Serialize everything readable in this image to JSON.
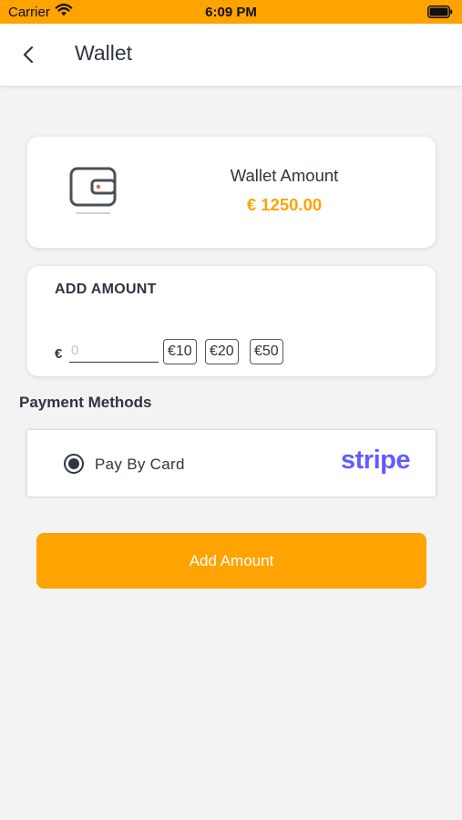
{
  "status_bar": {
    "carrier": "Carrier",
    "time": "6:09 PM"
  },
  "header": {
    "title": "Wallet"
  },
  "wallet": {
    "label": "Wallet Amount",
    "amount": "€ 1250.00"
  },
  "add_amount": {
    "heading": "ADD AMOUNT",
    "currency_symbol": "€",
    "input_value": "",
    "input_placeholder": "0",
    "quick_amounts": [
      "€10",
      "€20",
      "€50"
    ]
  },
  "payment": {
    "section_title": "Payment Methods",
    "method_label": "Pay By Card",
    "provider_logo": "stripe",
    "selected": true
  },
  "submit": {
    "label": "Add Amount"
  },
  "colors": {
    "accent": "#ffa300",
    "text": "#2f3542",
    "stripe": "#635bff",
    "background": "#f3f3f3"
  }
}
